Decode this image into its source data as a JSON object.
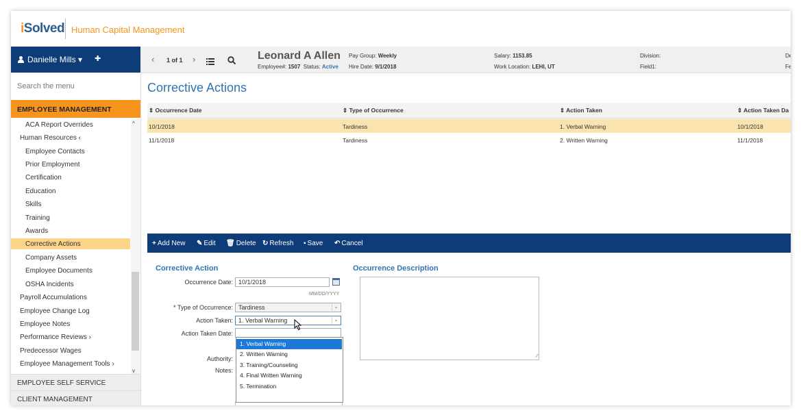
{
  "brand": {
    "logo_prefix": "i",
    "logo_rest": "Solved",
    "title": "Human Capital Management"
  },
  "user": {
    "name": "Danielle Mills",
    "caret": "▾",
    "pin": "✚"
  },
  "employee_header": {
    "prev": "‹",
    "next": "›",
    "pager": "1 of 1",
    "name": "Leonard A Allen",
    "employee_no_label": "Employee#:",
    "employee_no": "1507",
    "status_label": "Status:",
    "status": "Active",
    "pay_group_label": "Pay Group:",
    "pay_group": "Weekly",
    "hire_date_label": "Hire Date:",
    "hire_date": "9/1/2018",
    "salary_label": "Salary:",
    "salary": "1153.85",
    "work_location_label": "Work Location:",
    "work_location": "LEHI, UT",
    "division_label": "Division:",
    "field1_label": "Field1:",
    "cut1": "De",
    "cut2": "Fe"
  },
  "sidebar": {
    "search_placeholder": "Search the menu",
    "section": "EMPLOYEE MANAGEMENT",
    "items": [
      {
        "label": "ACA Report Overrides"
      },
      {
        "label": "Human Resources ‹"
      },
      {
        "label": "Employee Contacts"
      },
      {
        "label": "Prior Employment"
      },
      {
        "label": "Certification"
      },
      {
        "label": "Education"
      },
      {
        "label": "Skills"
      },
      {
        "label": "Training"
      },
      {
        "label": "Awards"
      },
      {
        "label": "Corrective Actions"
      },
      {
        "label": "Company Assets"
      },
      {
        "label": "Employee Documents"
      },
      {
        "label": "OSHA Incidents"
      },
      {
        "label": "Payroll Accumulations"
      },
      {
        "label": "Employee Change Log"
      },
      {
        "label": "Employee Notes"
      },
      {
        "label": "Performance Reviews ›"
      },
      {
        "label": "Predecessor Wages"
      },
      {
        "label": "Employee Management Tools ›"
      }
    ],
    "scroll_up": "^",
    "scroll_down": "v",
    "lower_sections": [
      "EMPLOYEE SELF SERVICE",
      "CLIENT MANAGEMENT"
    ]
  },
  "main": {
    "title": "Corrective Actions",
    "columns": [
      "Occurrence Date",
      "Type of Occurrence",
      "Action Taken",
      "Action Taken Da"
    ],
    "sort_glyph": "⇕",
    "rows": [
      [
        "10/1/2018",
        "Tardiness",
        "1. Verbal Warning",
        "10/1/2018"
      ],
      [
        "11/1/2018",
        "Tardiness",
        "2. Written Warning",
        "11/1/2018"
      ]
    ]
  },
  "toolbar": {
    "add_icon": "+",
    "add": "Add New",
    "edit_icon": "✎",
    "edit": "Edit",
    "delete_icon": "🗑",
    "delete": "Delete",
    "refresh_icon": "↻",
    "refresh": "Refresh",
    "save_icon": "▪",
    "save": "Save",
    "cancel_icon": "↶",
    "cancel": "Cancel"
  },
  "form": {
    "section_title": "Corrective Action",
    "desc_title": "Occurrence Description",
    "occurrence_date_label": "Occurrence Date:",
    "occurrence_date": "10/1/2018",
    "date_hint": "MM/DD/YYYY",
    "type_label": "* Type of Occurrence:",
    "type_value": "Tardiness",
    "action_label": "Action Taken:",
    "action_value": "1. Verbal Warning",
    "action_date_label": "Action Taken Date:",
    "authority_label": "Authority:",
    "notes_label": "Notes:",
    "caret": "⌄",
    "resize": "⁄⁄",
    "action_options": [
      "1. Verbal Warning",
      "2. Written Warning",
      "3. Training/Counseling",
      "4. Final Written Warning",
      "5. Termination"
    ]
  },
  "colors": {
    "navy": "#0d3c78",
    "orange": "#f7941d",
    "link_blue": "#2e74b5",
    "highlight": "#fbe3b0"
  }
}
